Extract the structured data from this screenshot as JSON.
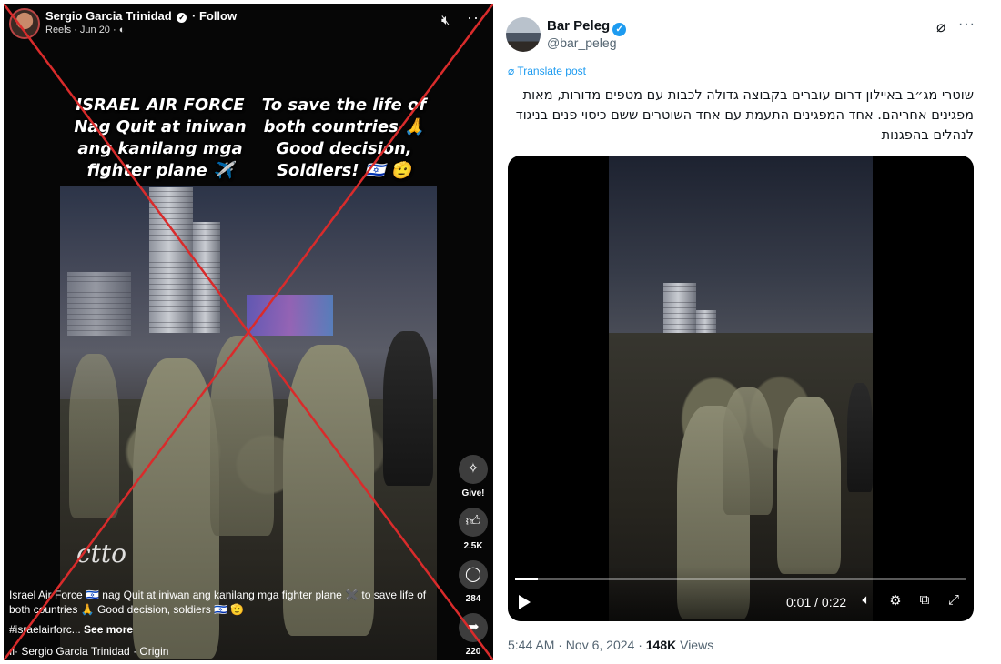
{
  "facebook_reel": {
    "author": "Sergio Garcia Trinidad",
    "follow_label": "Follow",
    "meta": "Reels · Jun 20 ·",
    "overlay_left": "ISRAEL AIR FORCE Nag Quit at iniwan ang kanilang mga fighter plane ✈️",
    "overlay_right": "To save the life of both countries 🙏 Good decision, Soldiers! 🇮🇱 🫡",
    "watermark": "ctto",
    "actions": [
      {
        "icon": "gift-icon",
        "label": "Give!"
      },
      {
        "icon": "like-icon",
        "label": "2.5K"
      },
      {
        "icon": "comment-icon",
        "label": "284"
      },
      {
        "icon": "share-icon",
        "label": "220"
      }
    ],
    "description": "Israel Air Force 🇮🇱 nag Quit at iniwan ang kanilang mga fighter plane ✖️ to save life of both countries 🙏 Good decision, soldiers 🇮🇱 🫡",
    "hashtags": "#israelairforc...",
    "see_more": "See more",
    "origin": "Sergio Garcia Trinidad · Origin"
  },
  "x_post": {
    "name": "Bar Peleg",
    "handle": "@bar_peleg",
    "translate_label": "Translate post",
    "text": "שוטרי מג״ב באיילון דרום  עוברים בקבוצה גדולה לכבות עם מטפים מדורות, מאות מפגינים אחריהם. אחד המפגינים התעמת עם אחד השוטרים ששם כיסוי פנים בניגוד לנהלים בהפגנות",
    "video_time": "0:01 / 0:22",
    "video_progress": 0.05,
    "timestamp": "5:44 AM · Nov 6, 2024 ·",
    "views_count": "148K",
    "views_label": "Views"
  },
  "colors": {
    "cross_red": "#d92b2b",
    "x_blue": "#1d9bf0"
  }
}
